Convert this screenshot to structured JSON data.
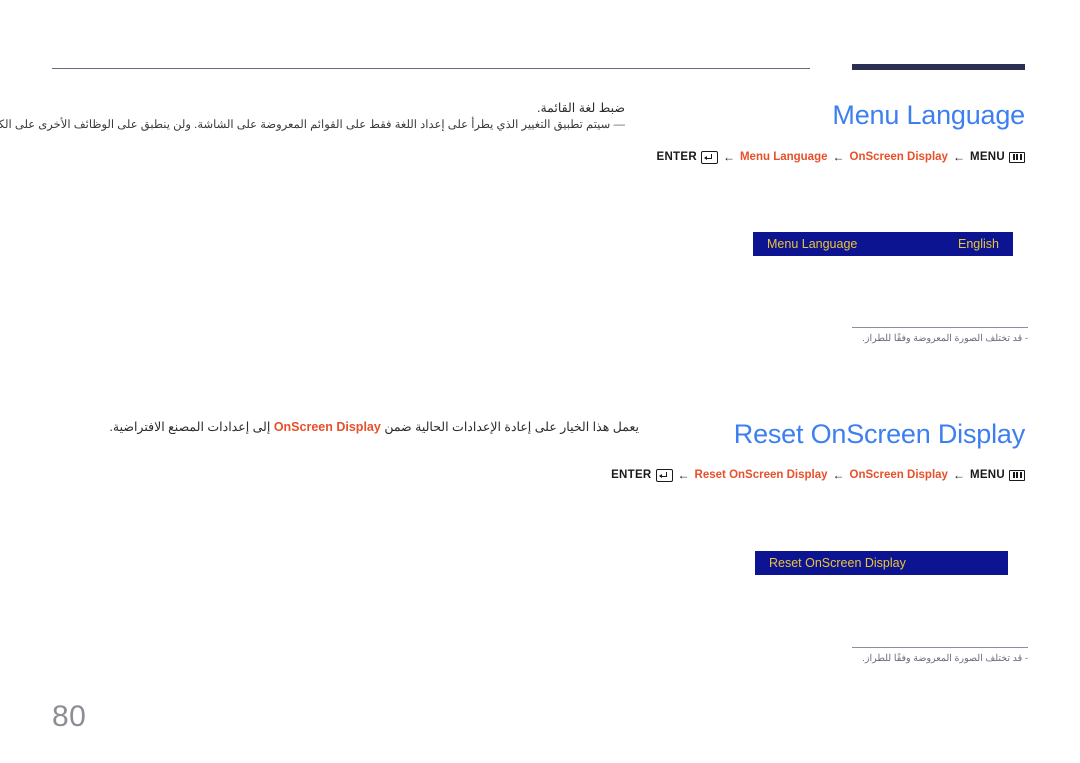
{
  "page": {
    "number": "80"
  },
  "icons": {
    "enter": "enter-key-icon",
    "menu": "menu-bars-icon",
    "arrow": "←"
  },
  "colors": {
    "heading_blue": "#3d7ff0",
    "breadcrumb_red": "#e8502a",
    "osd_box_background": "#0d1491",
    "osd_text_yellow": "#e8c53a",
    "top_bar_navy": "#2b3053",
    "rule_grey": "#6b6880",
    "page_number_grey": "#8d8d95"
  },
  "sections": [
    {
      "id": "menu-language",
      "title": "Menu Language",
      "breadcrumb": {
        "enter_label": "ENTER",
        "items": [
          "Menu Language",
          "OnScreen Display"
        ],
        "menu_label": "MENU"
      },
      "body": {
        "lead": "ضبط لغة القائمة.",
        "note_dash": "―",
        "note": "سيتم تطبيق التغيير الذي يطرأ على إعداد اللغة فقط على القوائم المعروضة على الشاشة. ولن ينطبق على الوظائف الأخرى على الكمبيوتر."
      },
      "osd": {
        "label": "Menu Language",
        "value": "English"
      },
      "footnote": "- قد تختلف الصورة المعروضة وفقًا للطراز."
    },
    {
      "id": "reset-onscreen-display",
      "title": "Reset OnScreen Display",
      "breadcrumb": {
        "enter_label": "ENTER",
        "items": [
          "Reset OnScreen Display",
          "OnScreen Display"
        ],
        "menu_label": "MENU"
      },
      "body": {
        "text_before": "يعمل هذا الخيار على إعادة الإعدادات الحالية ضمن",
        "inline_term": "OnScreen Display",
        "text_after": "إلى إعدادات المصنع الافتراضية."
      },
      "osd": {
        "label": "Reset OnScreen Display",
        "value": ""
      },
      "footnote": "- قد تختلف الصورة المعروضة وفقًا للطراز."
    }
  ]
}
